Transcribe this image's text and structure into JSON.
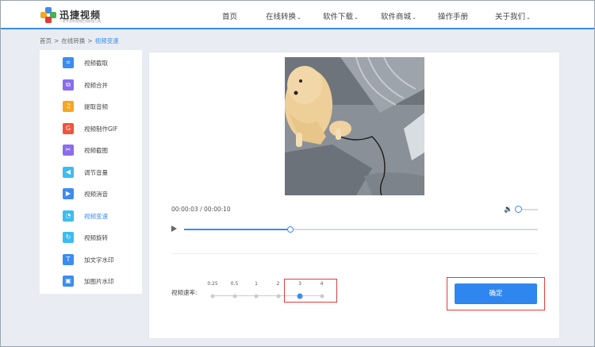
{
  "header": {
    "logo_name": "迅捷视频",
    "logo_sub": "一款专业的视频在线处理工具",
    "nav": [
      {
        "label": "首页",
        "dropdown": false
      },
      {
        "label": "在线转换",
        "dropdown": true
      },
      {
        "label": "软件下载",
        "dropdown": true
      },
      {
        "label": "软件商城",
        "dropdown": true
      },
      {
        "label": "操作手册",
        "dropdown": false
      },
      {
        "label": "关于我们",
        "dropdown": true
      }
    ]
  },
  "breadcrumb": [
    "首页",
    "在线转换",
    "视频变速"
  ],
  "sidebar": {
    "items": [
      {
        "label": "视频截取",
        "icon": "crop-icon",
        "color": "#3c8cf0",
        "glyph": "⌗"
      },
      {
        "label": "视频合并",
        "icon": "merge-icon",
        "color": "#8a6cf0",
        "glyph": "⧉"
      },
      {
        "label": "提取音频",
        "icon": "headphones-icon",
        "color": "#f5a623",
        "glyph": "♫"
      },
      {
        "label": "视频制作GIF",
        "icon": "gif-icon",
        "color": "#f0553c",
        "glyph": "G"
      },
      {
        "label": "视频截图",
        "icon": "scissors-icon",
        "color": "#8a6cf0",
        "glyph": "✂"
      },
      {
        "label": "调节音量",
        "icon": "volume-icon",
        "color": "#3cbcf0",
        "glyph": "◀"
      },
      {
        "label": "视频消音",
        "icon": "play-icon",
        "color": "#3c8cf0",
        "glyph": "▶"
      },
      {
        "label": "视频变速",
        "icon": "speed-icon",
        "color": "#3cbcf0",
        "glyph": "◔",
        "active": true
      },
      {
        "label": "视频旋转",
        "icon": "rotate-icon",
        "color": "#3cbcf0",
        "glyph": "↻"
      },
      {
        "label": "加文字水印",
        "icon": "text-watermark-icon",
        "color": "#3c8cf0",
        "glyph": "T"
      },
      {
        "label": "加图片水印",
        "icon": "image-watermark-icon",
        "color": "#3c8cf0",
        "glyph": "▣"
      }
    ]
  },
  "player": {
    "current_time": "00:00:03",
    "separator": "/",
    "total_time": "00:00:10",
    "progress": 0.3,
    "volume": 0.0
  },
  "speed": {
    "label": "视频速率:",
    "options": [
      "0.25",
      "0.5",
      "1",
      "2",
      "3",
      "4"
    ],
    "selected": "3"
  },
  "confirm_label": "确定",
  "colors": {
    "accent": "#3b8cef",
    "highlight": "#e03c3c"
  }
}
